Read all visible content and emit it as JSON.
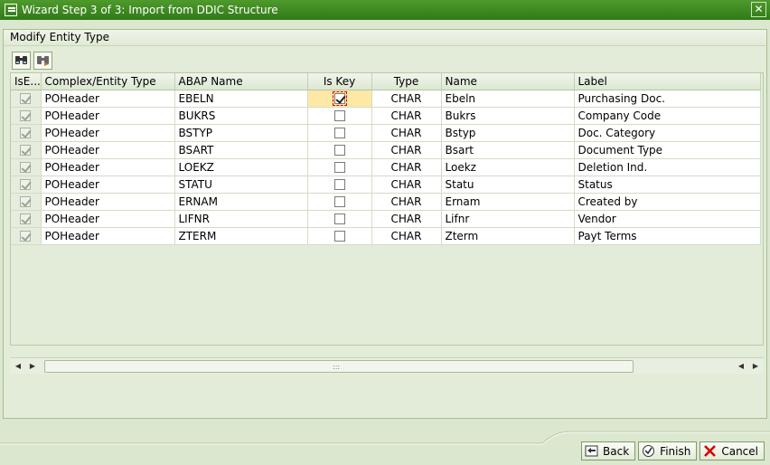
{
  "window": {
    "title": "Wizard Step 3 of 3: Import from DDIC Structure",
    "close_glyph": "✕"
  },
  "section": {
    "title": "Modify Entity Type"
  },
  "toolbar": {
    "icons": [
      "find-icon",
      "find-next-icon"
    ]
  },
  "table": {
    "columns": [
      "IsE...",
      "Complex/Entity Type",
      "ABAP Name",
      "Is Key",
      "Type",
      "Name",
      "Label"
    ],
    "rows": [
      {
        "entity_type": "POHeader",
        "abap_name": "EBELN",
        "is_key": true,
        "type": "CHAR",
        "name": "Ebeln",
        "label": "Purchasing Doc."
      },
      {
        "entity_type": "POHeader",
        "abap_name": "BUKRS",
        "is_key": false,
        "type": "CHAR",
        "name": "Bukrs",
        "label": "Company Code"
      },
      {
        "entity_type": "POHeader",
        "abap_name": "BSTYP",
        "is_key": false,
        "type": "CHAR",
        "name": "Bstyp",
        "label": "Doc. Category"
      },
      {
        "entity_type": "POHeader",
        "abap_name": "BSART",
        "is_key": false,
        "type": "CHAR",
        "name": "Bsart",
        "label": "Document Type"
      },
      {
        "entity_type": "POHeader",
        "abap_name": "LOEKZ",
        "is_key": false,
        "type": "CHAR",
        "name": "Loekz",
        "label": "Deletion Ind."
      },
      {
        "entity_type": "POHeader",
        "abap_name": "STATU",
        "is_key": false,
        "type": "CHAR",
        "name": "Statu",
        "label": "Status"
      },
      {
        "entity_type": "POHeader",
        "abap_name": "ERNAM",
        "is_key": false,
        "type": "CHAR",
        "name": "Ernam",
        "label": "Created by"
      },
      {
        "entity_type": "POHeader",
        "abap_name": "LIFNR",
        "is_key": false,
        "type": "CHAR",
        "name": "Lifnr",
        "label": "Vendor"
      },
      {
        "entity_type": "POHeader",
        "abap_name": "ZTERM",
        "is_key": false,
        "type": "CHAR",
        "name": "Zterm",
        "label": "Payt Terms"
      }
    ]
  },
  "scroll": {
    "left_arrow": "◀",
    "right_arrow": "▶",
    "grip": ":::"
  },
  "buttons": {
    "back": "Back",
    "finish": "Finish",
    "cancel": "Cancel"
  },
  "colors": {
    "titlebar": "#3d8a22",
    "background": "#e3ecd8",
    "focus_cell": "#fde8a6",
    "cancel_icon": "#d40000"
  }
}
